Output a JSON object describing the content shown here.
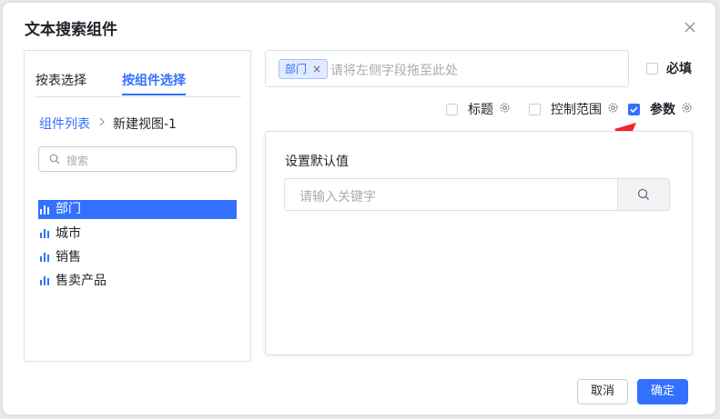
{
  "dialog": {
    "title": "文本搜索组件"
  },
  "tabs": [
    {
      "label": "按表选择"
    },
    {
      "label": "按组件选择"
    }
  ],
  "breadcrumb": {
    "root": "组件列表",
    "current": "新建视图-1"
  },
  "search": {
    "placeholder": "搜索"
  },
  "fields": [
    {
      "label": "部门",
      "icon": "bar-chart-icon",
      "selected": true
    },
    {
      "label": "城市",
      "icon": "bar-chart-icon",
      "selected": false
    },
    {
      "label": "销售",
      "icon": "bar-chart-icon",
      "selected": false
    },
    {
      "label": "售卖产品",
      "icon": "bar-chart-icon",
      "selected": false
    }
  ],
  "dropzone": {
    "tag": "部门",
    "hint": "请将左侧字段拖至此处"
  },
  "options": {
    "required": {
      "label": "必填",
      "checked": false
    },
    "title": {
      "label": "标题",
      "checked": false
    },
    "control_range": {
      "label": "控制范围",
      "checked": false
    },
    "params": {
      "label": "参数",
      "checked": true
    }
  },
  "default_value": {
    "title": "设置默认值",
    "placeholder": "请输入关键字"
  },
  "footer": {
    "cancel": "取消",
    "ok": "确定"
  },
  "colors": {
    "accent": "#3370ff",
    "arrow": "#f5222d"
  }
}
